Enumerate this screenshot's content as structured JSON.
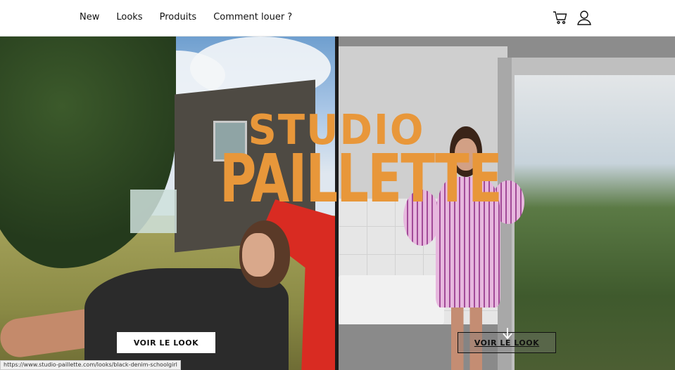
{
  "header": {
    "nav": [
      {
        "label": "New"
      },
      {
        "label": "Looks"
      },
      {
        "label": "Produits"
      },
      {
        "label": "Comment louer ?"
      }
    ],
    "icons": [
      "cart-icon",
      "user-icon"
    ]
  },
  "hero": {
    "logo_line1": "STUDIO",
    "logo_line2": "PAILLETTE",
    "logo_color": "#e8973a",
    "left_button": "VOIR LE LOOK",
    "right_button": "VOIR LE LOOK"
  },
  "status_url": "https://www.studio-paillette.com/looks/black-denim-schoolgirl"
}
